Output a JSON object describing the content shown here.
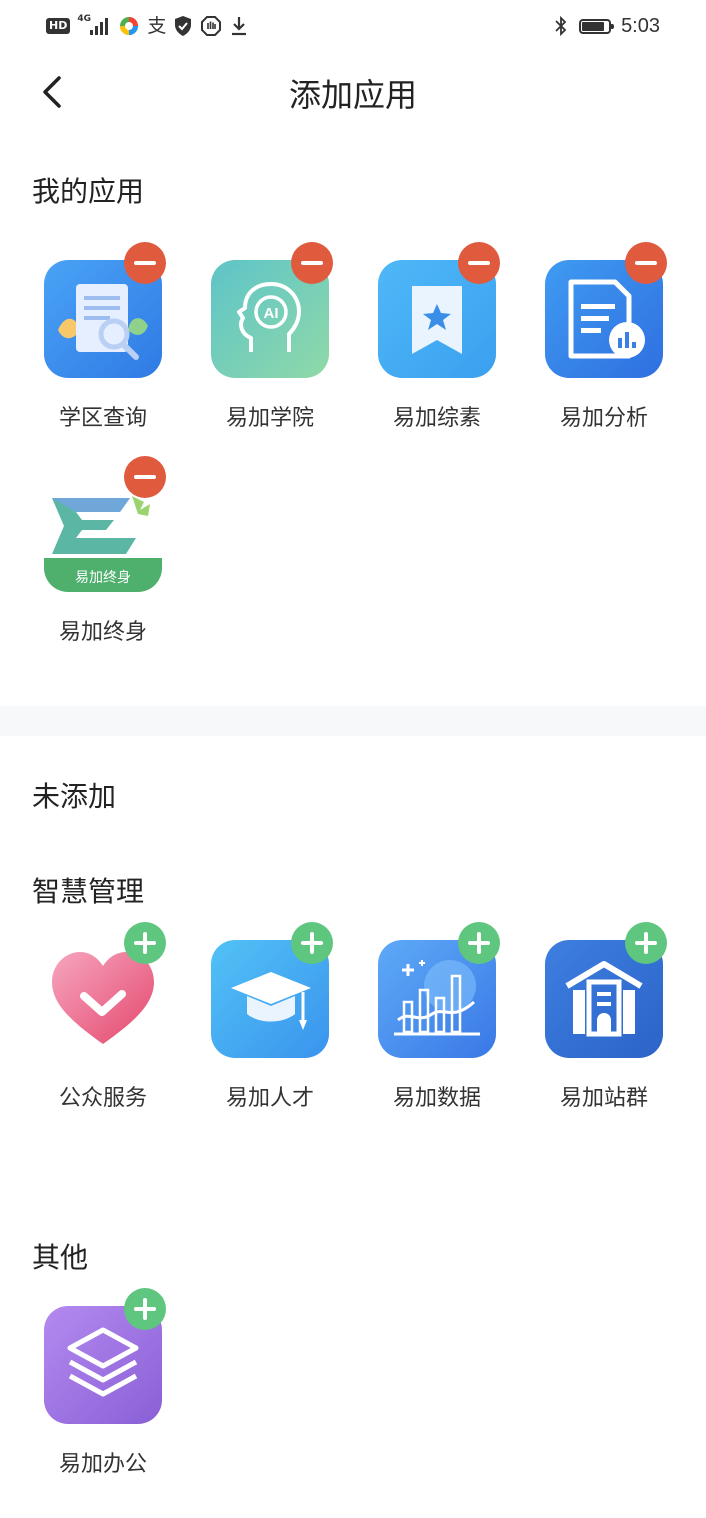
{
  "status_bar": {
    "hd": "HD",
    "network": "4G",
    "icons": [
      "app-icon",
      "alipay-icon",
      "shield-icon",
      "hand-icon",
      "download-icon",
      "bluetooth-icon",
      "battery-icon"
    ],
    "time": "5:03"
  },
  "nav": {
    "title": "添加应用"
  },
  "my_apps": {
    "title": "我的应用",
    "items": [
      {
        "label": "学区查询"
      },
      {
        "label": "易加学院"
      },
      {
        "label": "易加综素"
      },
      {
        "label": "易加分析"
      },
      {
        "label": "易加终身",
        "icon_text": "易加终身"
      }
    ]
  },
  "not_added": {
    "title": "未添加",
    "groups": [
      {
        "title": "智慧管理",
        "items": [
          {
            "label": "公众服务"
          },
          {
            "label": "易加人才"
          },
          {
            "label": "易加数据"
          },
          {
            "label": "易加站群"
          }
        ]
      },
      {
        "title": "其他",
        "items": [
          {
            "label": "易加办公"
          }
        ]
      }
    ]
  },
  "colors": {
    "remove_badge": "#e05a3e",
    "add_badge": "#5fc67f",
    "blue_icon": "#3d8ff0",
    "purple_icon": "#9b6fdc"
  }
}
